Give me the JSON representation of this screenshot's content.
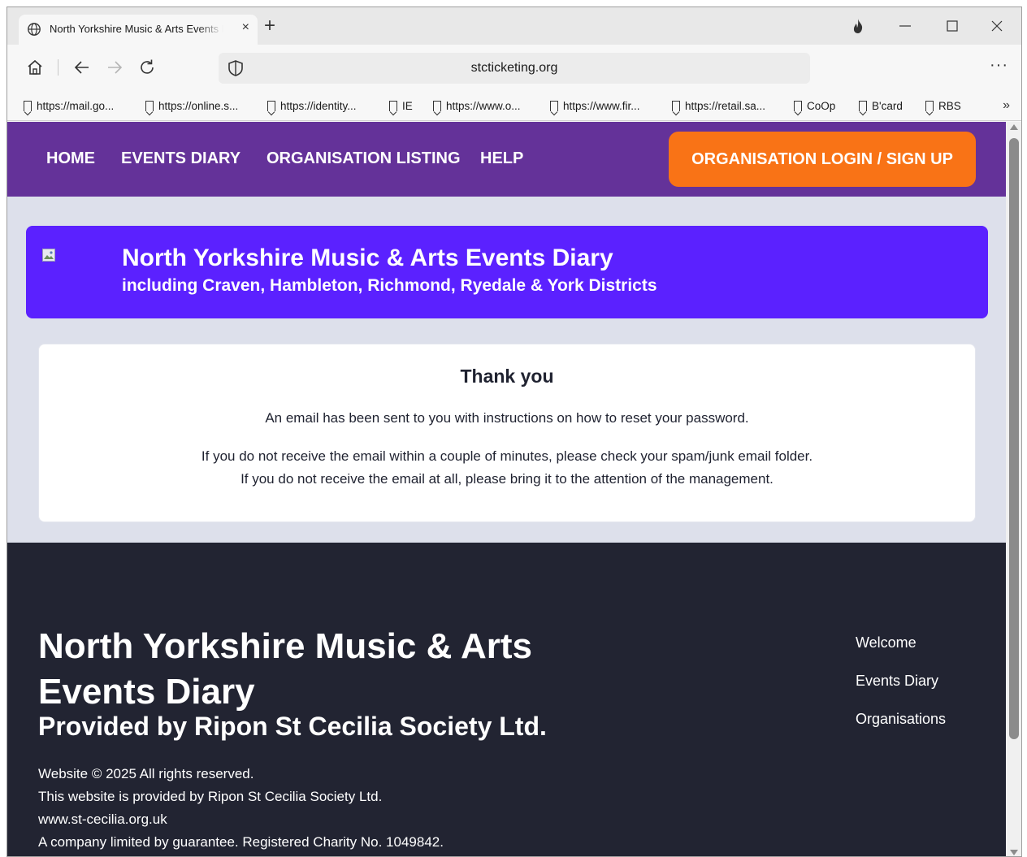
{
  "browser": {
    "tab_title": "North Yorkshire Music & Arts Events Diary",
    "tab_close": "×",
    "new_tab": "+",
    "url": "stcticketing.org",
    "more_menu": "···",
    "bookmarks_overflow": "»",
    "bookmarks": [
      "https://mail.go...",
      "https://online.s...",
      "https://identity...",
      "IE",
      "https://www.o...",
      "https://www.fir...",
      "https://retail.sa...",
      "CoOp",
      "B'card",
      "RBS"
    ]
  },
  "nav": {
    "home": "HOME",
    "events_diary": "EVENTS DIARY",
    "organisation_listing": "ORGANISATION LISTING",
    "help": "HELP",
    "login": "ORGANISATION LOGIN / SIGN UP"
  },
  "banner": {
    "title": "North Yorkshire Music & Arts Events Diary",
    "subtitle": "including Craven, Hambleton, Richmond, Ryedale & York Districts"
  },
  "message": {
    "title": "Thank you",
    "line1": "An email has been sent to you with instructions on how to reset your password.",
    "line2": "If you do not receive the email within a couple of minutes, please check your spam/junk email folder.",
    "line3": "If you do not receive the email at all, please bring it to the attention of the management."
  },
  "footer": {
    "title_line1": "North Yorkshire Music & Arts",
    "title_line2": "Events Diary",
    "subtitle": "Provided by Ripon St Cecilia Society Ltd.",
    "copyright": "Website © 2025 All rights reserved.",
    "provided_by": "This website is provided by Ripon St Cecilia Society Ltd.",
    "website": "www.st-cecilia.org.uk",
    "charity": "A company limited by guarantee. Registered Charity No. 1049842.",
    "links": [
      "Welcome",
      "Events Diary",
      "Organisations"
    ]
  },
  "colors": {
    "nav_bg": "#643299",
    "login_button": "#f97316",
    "banner_bg": "#5b21ff",
    "page_bg": "#dde0eb",
    "footer_bg": "#222432"
  }
}
